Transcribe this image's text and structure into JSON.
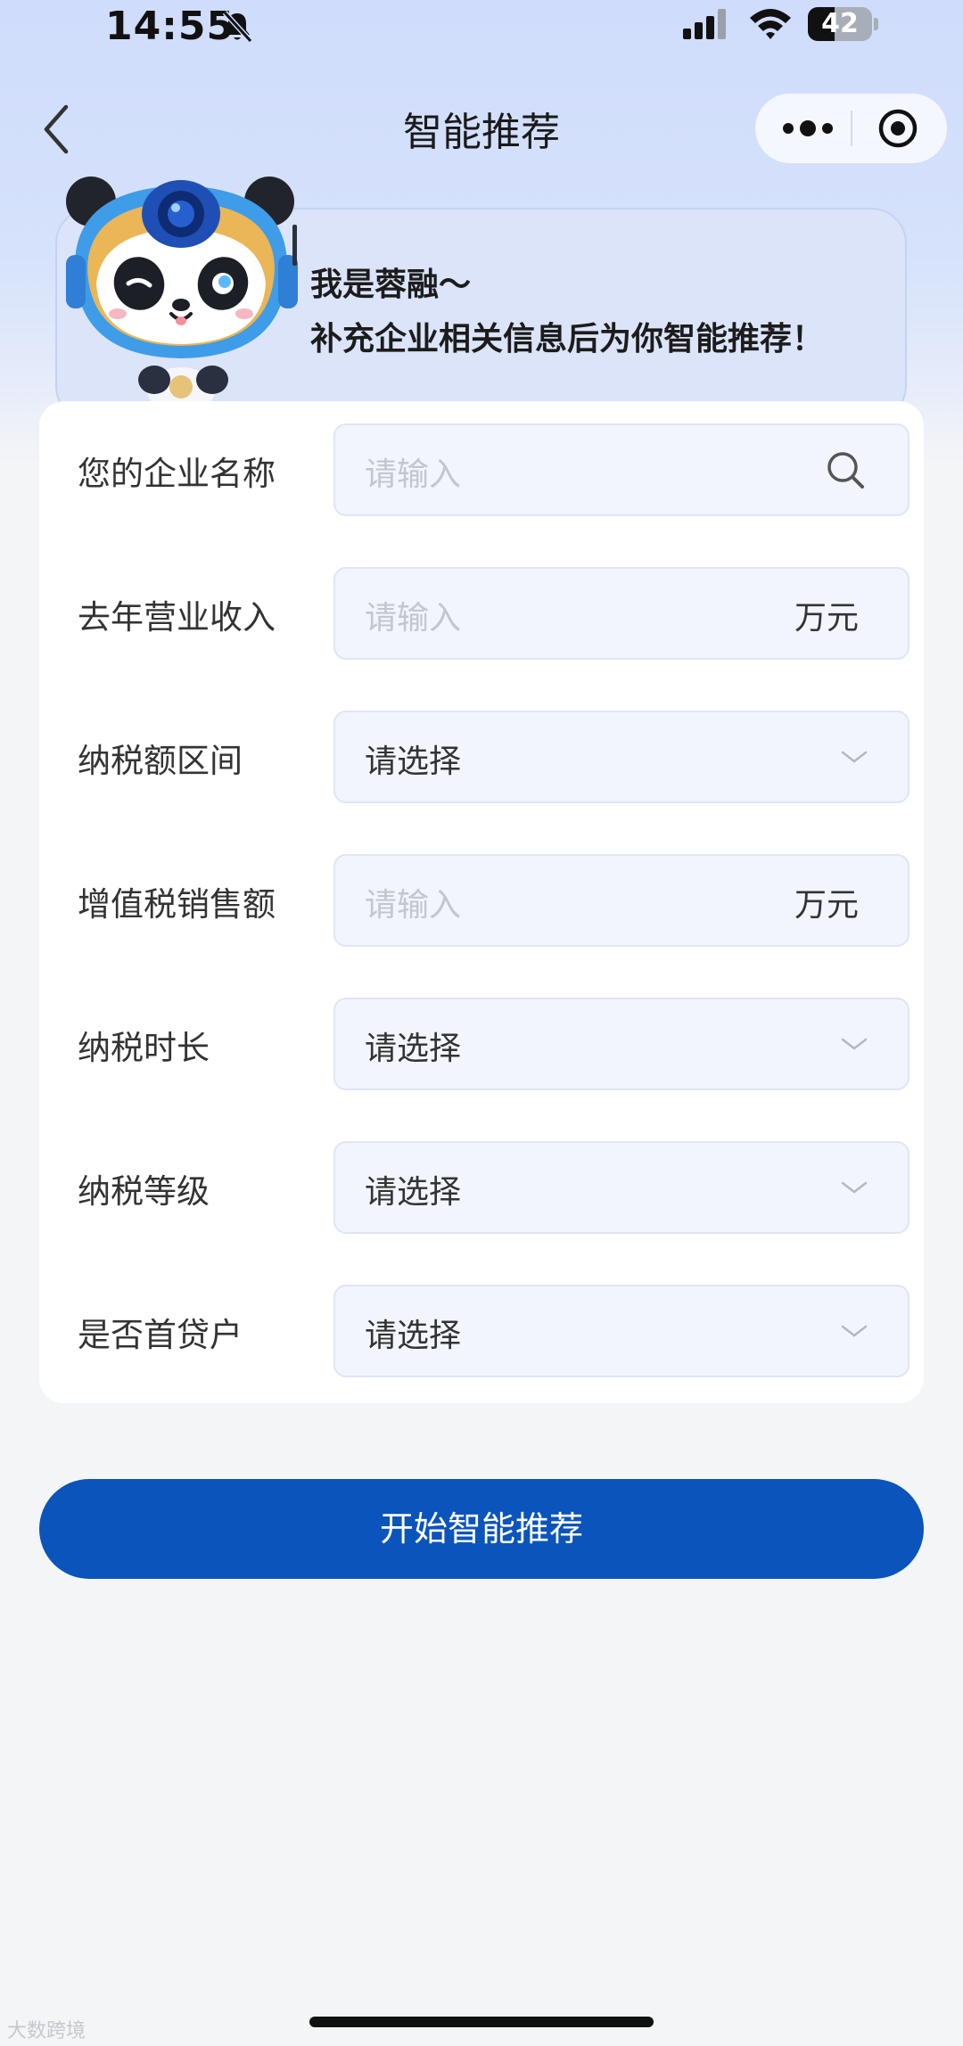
{
  "status_bar": {
    "time": "14:55",
    "battery_level": "42",
    "battery_fraction": 0.42,
    "icons": [
      "bell-muted-icon",
      "cellular-signal-icon",
      "wifi-icon",
      "battery-icon"
    ]
  },
  "nav": {
    "title": "智能推荐",
    "back_icon": "chevron-left-icon",
    "more_icon": "more-dots-icon",
    "close_icon": "target-circle-icon"
  },
  "banner": {
    "greeting_line1": "我是蓉融～",
    "greeting_line2": "补充企业相关信息后为你智能推荐！",
    "mascot": "panda-robot-mascot"
  },
  "form": {
    "fields": [
      {
        "label": "您的企业名称",
        "type": "search",
        "placeholder": "请输入",
        "icon": "search-icon"
      },
      {
        "label": "去年营业收入",
        "type": "number",
        "placeholder": "请输入",
        "unit": "万元"
      },
      {
        "label": "纳税额区间",
        "type": "select",
        "value": "请选择",
        "icon": "chevron-down-icon"
      },
      {
        "label": "增值税销售额",
        "type": "number",
        "placeholder": "请输入",
        "unit": "万元"
      },
      {
        "label": "纳税时长",
        "type": "select",
        "value": "请选择",
        "icon": "chevron-down-icon"
      },
      {
        "label": "纳税等级",
        "type": "select",
        "value": "请选择",
        "icon": "chevron-down-icon"
      },
      {
        "label": "是否首贷户",
        "type": "select",
        "value": "请选择",
        "icon": "chevron-down-icon"
      }
    ]
  },
  "submit_label": "开始智能推荐",
  "watermark": "大数跨境",
  "colors": {
    "primary": "#0a54bb",
    "field_bg": "#f2f5fd",
    "placeholder": "#c3c6cd",
    "header_gradient_top": "#cfdcfb"
  }
}
